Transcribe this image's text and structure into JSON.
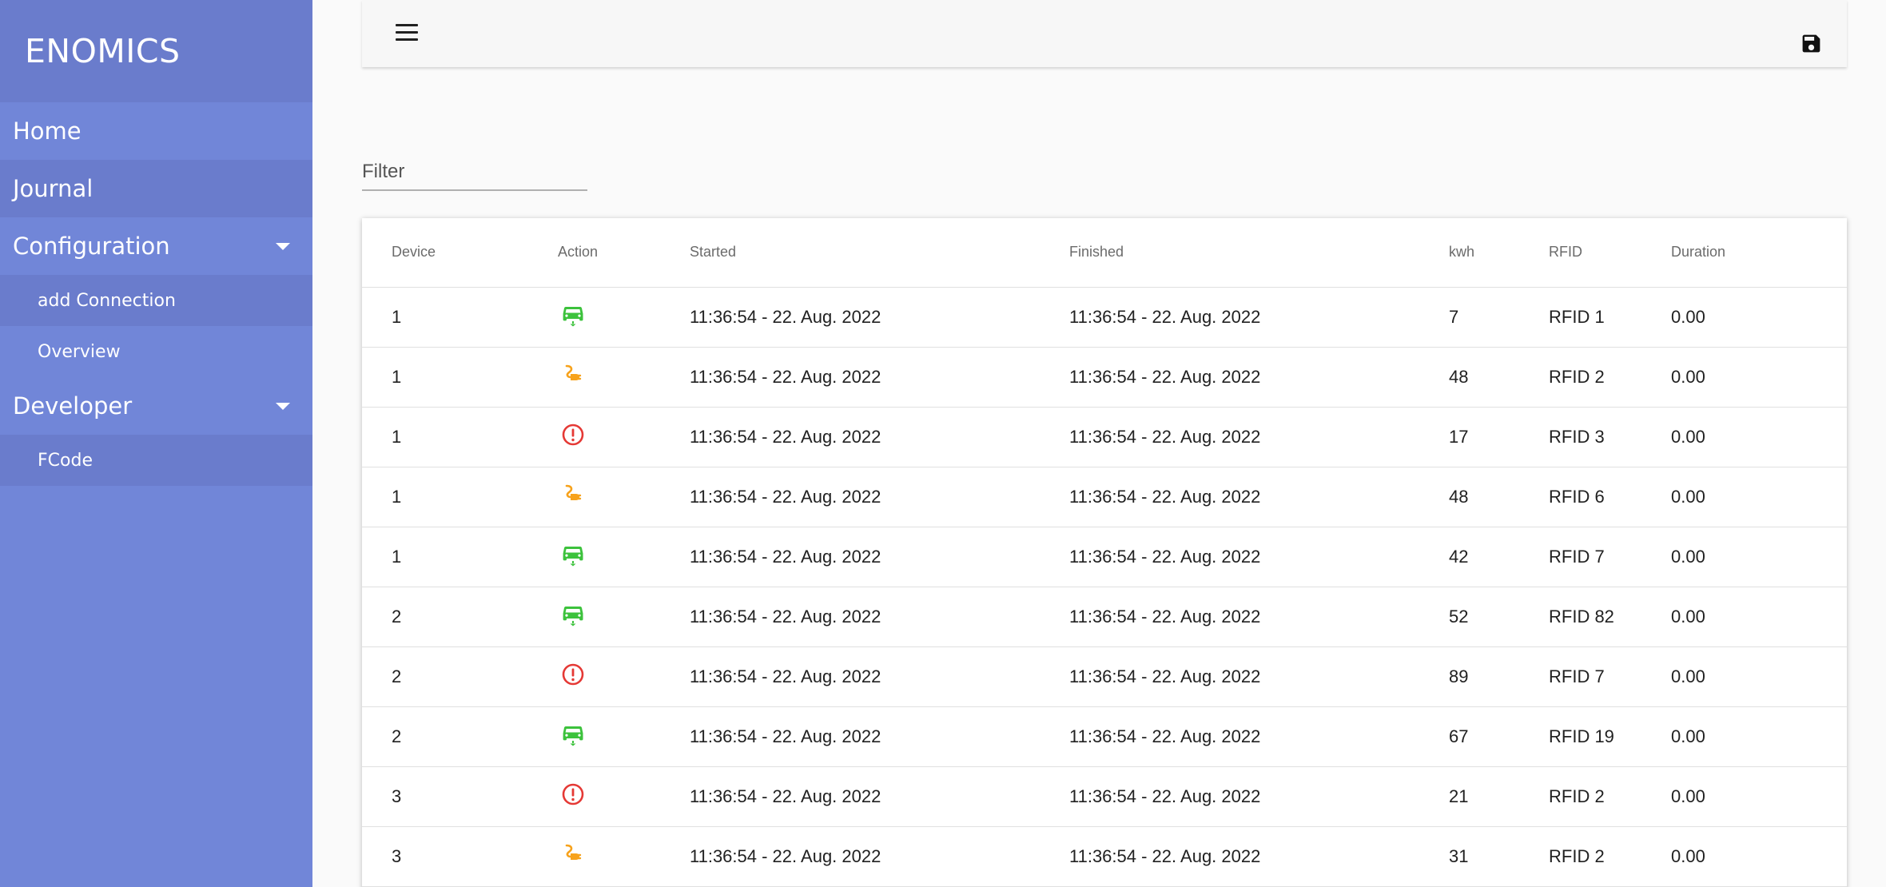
{
  "app": {
    "brand": "ENOMICS"
  },
  "sidebar": {
    "items": [
      {
        "label": "Home"
      },
      {
        "label": "Journal"
      },
      {
        "label": "Configuration",
        "children": [
          {
            "label": "add Connection"
          },
          {
            "label": "Overview"
          }
        ]
      },
      {
        "label": "Developer",
        "children": [
          {
            "label": "FCode"
          }
        ]
      }
    ]
  },
  "toolbar": {
    "menu_icon": "hamburger-menu-icon",
    "save_icon": "floppy-disk-icon"
  },
  "filter": {
    "placeholder": "Filter",
    "value": ""
  },
  "table": {
    "headers": [
      "Device",
      "Action",
      "Started",
      "Finished",
      "kwh",
      "RFID",
      "Duration"
    ],
    "rows": [
      {
        "device": "1",
        "action": "car-charging-icon",
        "started": "11:36:54 - 22. Aug. 2022",
        "finished": "11:36:54 - 22. Aug. 2022",
        "kwh": "7",
        "rfid": "RFID 1",
        "duration": "0.00"
      },
      {
        "device": "1",
        "action": "plug-icon",
        "started": "11:36:54 - 22. Aug. 2022",
        "finished": "11:36:54 - 22. Aug. 2022",
        "kwh": "48",
        "rfid": "RFID 2",
        "duration": "0.00"
      },
      {
        "device": "1",
        "action": "error-icon",
        "started": "11:36:54 - 22. Aug. 2022",
        "finished": "11:36:54 - 22. Aug. 2022",
        "kwh": "17",
        "rfid": "RFID 3",
        "duration": "0.00"
      },
      {
        "device": "1",
        "action": "plug-icon",
        "started": "11:36:54 - 22. Aug. 2022",
        "finished": "11:36:54 - 22. Aug. 2022",
        "kwh": "48",
        "rfid": "RFID 6",
        "duration": "0.00"
      },
      {
        "device": "1",
        "action": "car-charging-icon",
        "started": "11:36:54 - 22. Aug. 2022",
        "finished": "11:36:54 - 22. Aug. 2022",
        "kwh": "42",
        "rfid": "RFID 7",
        "duration": "0.00"
      },
      {
        "device": "2",
        "action": "car-charging-icon",
        "started": "11:36:54 - 22. Aug. 2022",
        "finished": "11:36:54 - 22. Aug. 2022",
        "kwh": "52",
        "rfid": "RFID 82",
        "duration": "0.00"
      },
      {
        "device": "2",
        "action": "error-icon",
        "started": "11:36:54 - 22. Aug. 2022",
        "finished": "11:36:54 - 22. Aug. 2022",
        "kwh": "89",
        "rfid": "RFID 7",
        "duration": "0.00"
      },
      {
        "device": "2",
        "action": "car-charging-icon",
        "started": "11:36:54 - 22. Aug. 2022",
        "finished": "11:36:54 - 22. Aug. 2022",
        "kwh": "67",
        "rfid": "RFID 19",
        "duration": "0.00"
      },
      {
        "device": "3",
        "action": "error-icon",
        "started": "11:36:54 - 22. Aug. 2022",
        "finished": "11:36:54 - 22. Aug. 2022",
        "kwh": "21",
        "rfid": "RFID 2",
        "duration": "0.00"
      },
      {
        "device": "3",
        "action": "plug-icon",
        "started": "11:36:54 - 22. Aug. 2022",
        "finished": "11:36:54 - 22. Aug. 2022",
        "kwh": "31",
        "rfid": "RFID 2",
        "duration": "0.00"
      }
    ]
  },
  "colors": {
    "sidebar_bg": "#7186d8",
    "sidebar_active": "#6a7ccc",
    "car_icon": "#3cc23c",
    "plug_icon": "#f7a21b",
    "error_icon": "#e53935"
  }
}
